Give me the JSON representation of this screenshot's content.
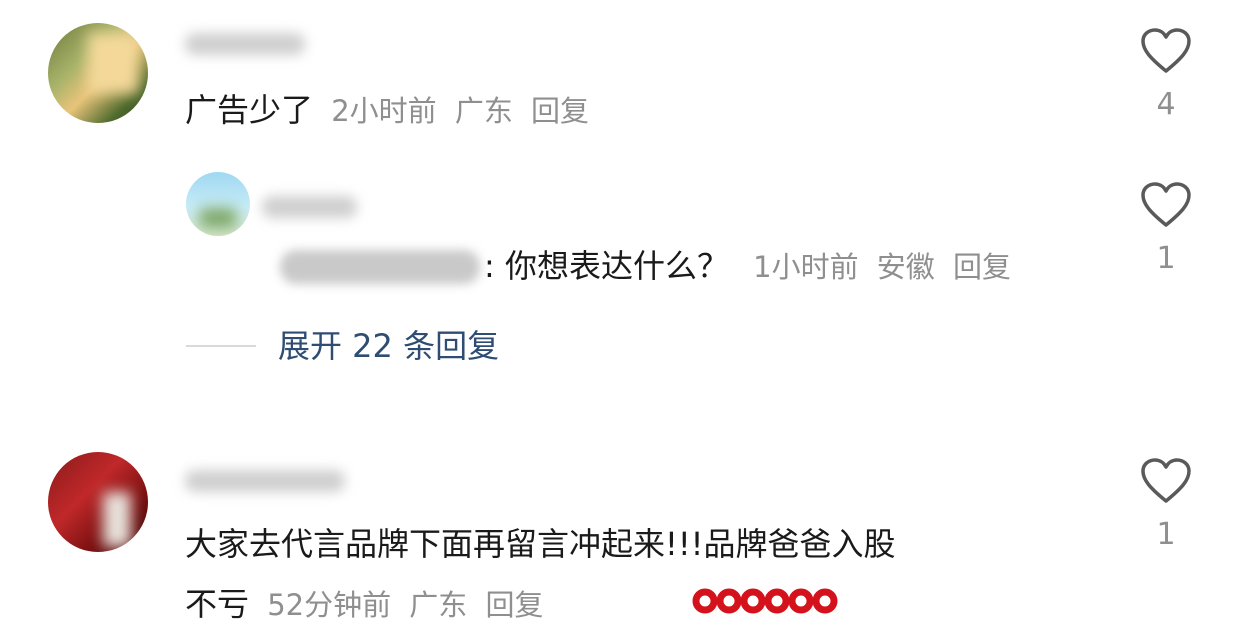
{
  "comments": [
    {
      "text": "广告少了",
      "time": "2小时前",
      "location": "广东",
      "reply_label": "回复",
      "likes": "4"
    },
    {
      "reply_to_text": ": 你想表达什么？",
      "time": "1小时前",
      "location": "安徽",
      "reply_label": "回复",
      "likes": "1"
    },
    {
      "text_line1": "大家去代言品牌下面再留言冲起来!!!品牌爸爸入股",
      "text_line2": "不亏",
      "time": "52分钟前",
      "location": "广东",
      "reply_label": "回复",
      "likes": "1"
    }
  ],
  "expand_replies": "展开 22 条回复",
  "icons": {
    "like": "heart-outline-icon",
    "sticker": "red-rings-sticker"
  },
  "colors": {
    "text": "#1a1a1a",
    "meta": "#8f8f8f",
    "expand": "#2f4d72",
    "sticker_red": "#d4121c"
  }
}
